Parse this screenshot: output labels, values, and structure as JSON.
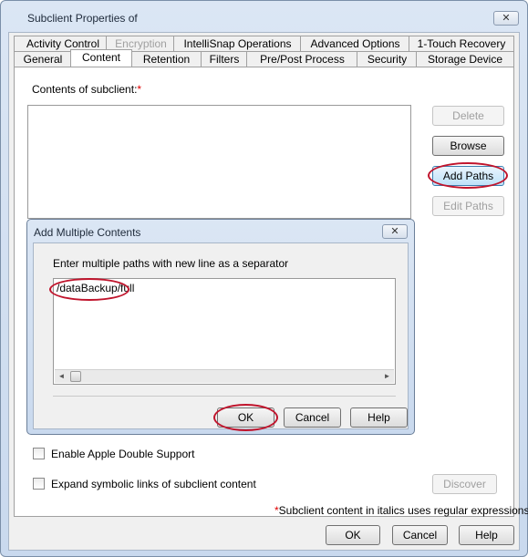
{
  "window": {
    "title": "Subclient Properties of",
    "close_glyph": "✕"
  },
  "tabs_row1": [
    {
      "label": "Activity Control"
    },
    {
      "label": "Encryption",
      "disabled": true
    },
    {
      "label": "IntelliSnap Operations"
    },
    {
      "label": "Advanced Options"
    },
    {
      "label": "1-Touch Recovery"
    }
  ],
  "tabs_row2": [
    {
      "label": "General"
    },
    {
      "label": "Content",
      "active": true
    },
    {
      "label": "Retention"
    },
    {
      "label": "Filters"
    },
    {
      "label": "Pre/Post Process"
    },
    {
      "label": "Security"
    },
    {
      "label": "Storage Device"
    }
  ],
  "content": {
    "label": "Contents of subclient:",
    "required_mark": "*",
    "buttons": {
      "delete": "Delete",
      "browse": "Browse",
      "add_paths": "Add Paths",
      "edit_paths": "Edit Paths"
    },
    "apple_double": "Enable Apple Double Support",
    "expand_symlinks": "Expand symbolic links of subclient content",
    "discover": "Discover",
    "footnote_mark": "*",
    "footnote": "Subclient content in italics uses regular expressions"
  },
  "dialog": {
    "title": "Add Multiple Contents",
    "close_glyph": "✕",
    "instruction": "Enter multiple paths with new line as a separator",
    "paths_text": "/dataBackup/full",
    "ok": "OK",
    "cancel": "Cancel",
    "help": "Help",
    "scroll_left": "◄",
    "scroll_right": "►"
  },
  "footer": {
    "ok": "OK",
    "cancel": "Cancel",
    "help": "Help"
  },
  "colors": {
    "annotation_ring": "#c0142c",
    "required_asterisk": "#e00000"
  }
}
